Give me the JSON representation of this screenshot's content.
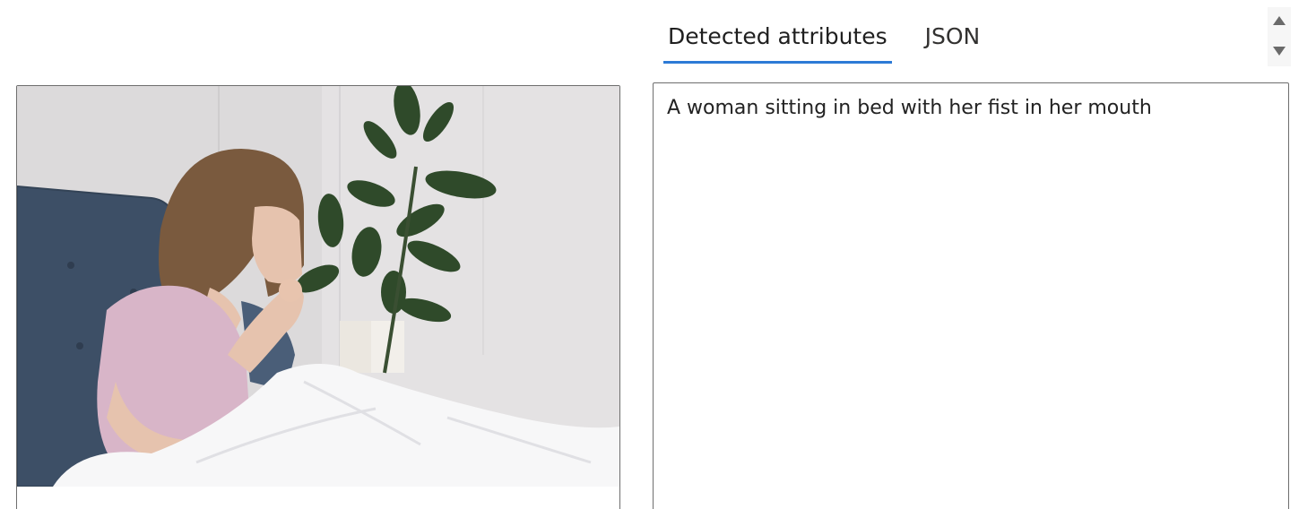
{
  "tabs": [
    {
      "label": "Detected attributes",
      "active": true
    },
    {
      "label": "JSON",
      "active": false
    }
  ],
  "result": {
    "caption": "A woman sitting in bed with her fist in her mouth"
  },
  "image": {
    "alt": "A woman sitting in bed with her fist in her mouth"
  },
  "colors": {
    "accent": "#2d7ad6",
    "border": "#6e6e6e"
  }
}
